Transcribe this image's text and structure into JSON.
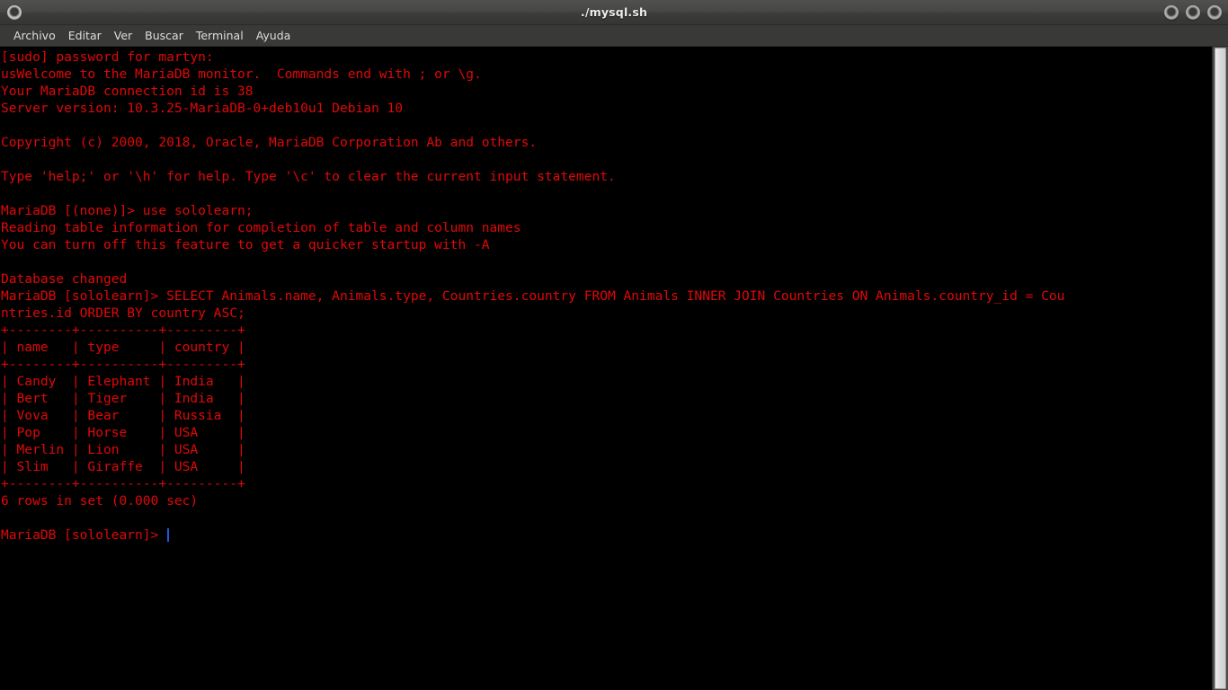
{
  "window": {
    "title": "./mysql.sh",
    "icon": "terminal-icon",
    "controls": [
      {
        "name": "minimize-button",
        "label": ""
      },
      {
        "name": "maximize-button",
        "label": ""
      },
      {
        "name": "close-button",
        "label": ""
      }
    ]
  },
  "menubar": {
    "items": [
      {
        "label": "Archivo"
      },
      {
        "label": "Editar"
      },
      {
        "label": "Ver"
      },
      {
        "label": "Buscar"
      },
      {
        "label": "Terminal"
      },
      {
        "label": "Ayuda"
      }
    ]
  },
  "colors": {
    "terminal_background": "#000000",
    "terminal_foreground": "#e00808",
    "cursor": "#2255dd",
    "titlebar": "#474746",
    "menubar": "#393938",
    "menu_text": "#dedede",
    "scrollbar_thumb": "#dcdcdc",
    "scrollbar_track": "#4a4a49"
  },
  "terminal": {
    "prompt_db_none": "MariaDB [(none)]>",
    "prompt_db_sololearn": "MariaDB [sololearn]>",
    "sudo_user": "martyn",
    "connection_id": "38",
    "server_version": "10.3.25-MariaDB-0+deb10u1 Debian 10",
    "database": "sololearn",
    "query": "SELECT Animals.name, Animals.type, Countries.country FROM Animals INNER JOIN Countries ON Animals.country_id = Countries.id ORDER BY country ASC;",
    "row_count_text": "6 rows in set (0.000 sec)",
    "lines": [
      "[sudo] password for martyn:",
      "usWelcome to the MariaDB monitor.  Commands end with ; or \\g.",
      "Your MariaDB connection id is 38",
      "Server version: 10.3.25-MariaDB-0+deb10u1 Debian 10",
      "",
      "Copyright (c) 2000, 2018, Oracle, MariaDB Corporation Ab and others.",
      "",
      "Type 'help;' or '\\h' for help. Type '\\c' to clear the current input statement.",
      "",
      "MariaDB [(none)]> use sololearn;",
      "Reading table information for completion of table and column names",
      "You can turn off this feature to get a quicker startup with -A",
      "",
      "Database changed",
      "MariaDB [sololearn]> SELECT Animals.name, Animals.type, Countries.country FROM Animals INNER JOIN Countries ON Animals.country_id = Cou",
      "ntries.id ORDER BY country ASC;",
      "+--------+----------+---------+",
      "| name   | type     | country |",
      "+--------+----------+---------+",
      "| Candy  | Elephant | India   |",
      "| Bert   | Tiger    | India   |",
      "| Vova   | Bear     | Russia  |",
      "| Pop    | Horse    | USA     |",
      "| Merlin | Lion     | USA     |",
      "| Slim   | Giraffe  | USA     |",
      "+--------+----------+---------+",
      "6 rows in set (0.000 sec)",
      "",
      "MariaDB [sololearn]> "
    ],
    "result_table": {
      "columns": [
        "name",
        "type",
        "country"
      ],
      "rows": [
        [
          "Candy",
          "Elephant",
          "India"
        ],
        [
          "Bert",
          "Tiger",
          "India"
        ],
        [
          "Vova",
          "Bear",
          "Russia"
        ],
        [
          "Pop",
          "Horse",
          "USA"
        ],
        [
          "Merlin",
          "Lion",
          "USA"
        ],
        [
          "Slim",
          "Giraffe",
          "USA"
        ]
      ]
    }
  }
}
